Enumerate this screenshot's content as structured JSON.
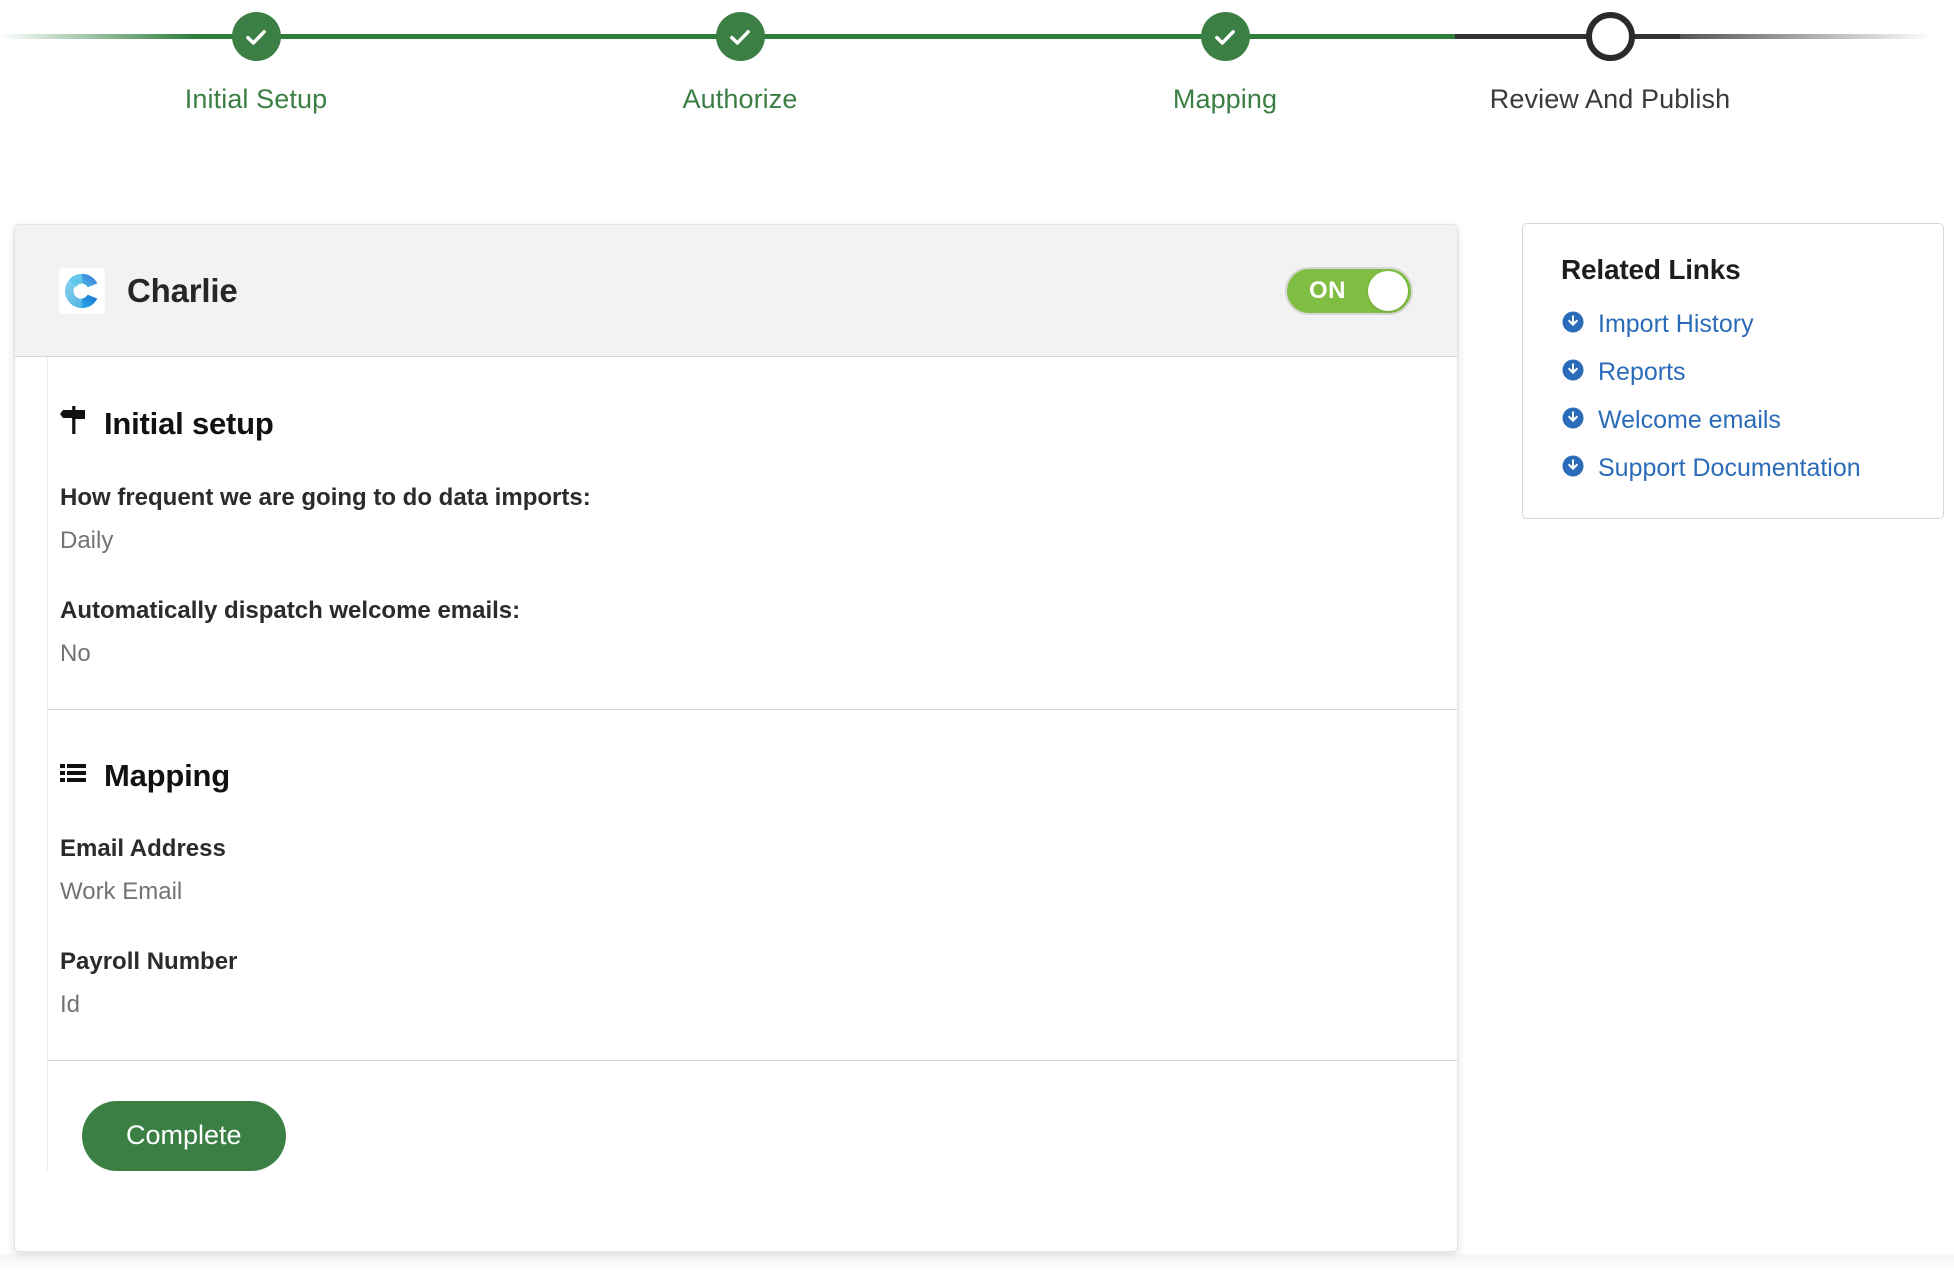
{
  "stepper": {
    "steps": [
      {
        "label": "Initial Setup",
        "state": "done"
      },
      {
        "label": "Authorize",
        "state": "done"
      },
      {
        "label": "Mapping",
        "state": "done"
      },
      {
        "label": "Review And Publish",
        "state": "current"
      }
    ],
    "done_color": "#3B7F45",
    "pending_color": "#2B2B2B"
  },
  "card": {
    "brand_name": "Charlie",
    "brand_logo_icon": "charlie-logo-icon",
    "toggle": {
      "label": "ON",
      "state": "on",
      "color": "#7FBE42"
    },
    "sections": [
      {
        "icon": "signpost-icon",
        "title": "Initial setup",
        "fields": [
          {
            "label": "How frequent we are going to do data imports:",
            "value": "Daily"
          },
          {
            "label": "Automatically dispatch welcome emails:",
            "value": "No"
          }
        ]
      },
      {
        "icon": "list-icon",
        "title": "Mapping",
        "fields": [
          {
            "label": "Email Address",
            "value": "Work Email"
          },
          {
            "label": "Payroll Number",
            "value": "Id"
          }
        ]
      }
    ],
    "complete_button": {
      "label": "Complete",
      "color": "#3B7F45"
    }
  },
  "related_links": {
    "title": "Related Links",
    "link_color": "#2B6CB8",
    "items": [
      {
        "label": "Import History",
        "icon": "circle-arrow-down-icon"
      },
      {
        "label": "Reports",
        "icon": "circle-arrow-down-icon"
      },
      {
        "label": "Welcome emails",
        "icon": "circle-arrow-down-icon"
      },
      {
        "label": "Support Documentation",
        "icon": "circle-arrow-down-icon"
      }
    ]
  }
}
